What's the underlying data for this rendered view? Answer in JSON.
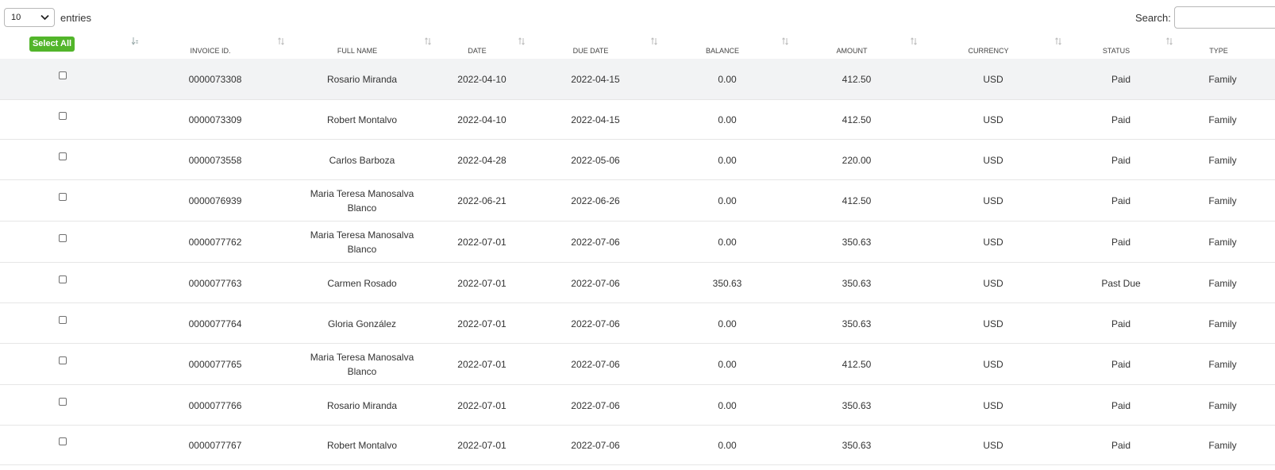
{
  "controls": {
    "page_length": "10",
    "entries_label": "entries",
    "search_label": "Search:",
    "search_value": ""
  },
  "header": {
    "select_all_label": "Select All",
    "columns": [
      {
        "key": "invoice_id",
        "label": "INVOICE ID."
      },
      {
        "key": "full_name",
        "label": "FULL NAME"
      },
      {
        "key": "date",
        "label": "DATE"
      },
      {
        "key": "due_date",
        "label": "DUE DATE"
      },
      {
        "key": "balance",
        "label": "BALANCE"
      },
      {
        "key": "amount",
        "label": "AMOUNT"
      },
      {
        "key": "currency",
        "label": "CURRENCY"
      },
      {
        "key": "status",
        "label": "STATUS"
      },
      {
        "key": "type",
        "label": "TYPE"
      }
    ]
  },
  "rows": [
    {
      "invoice_id": "0000073308",
      "full_name": "Rosario Miranda",
      "date": "2022-04-10",
      "due_date": "2022-04-15",
      "balance": "0.00",
      "amount": "412.50",
      "currency": "USD",
      "status": "Paid",
      "type": "Family"
    },
    {
      "invoice_id": "0000073309",
      "full_name": "Robert Montalvo",
      "date": "2022-04-10",
      "due_date": "2022-04-15",
      "balance": "0.00",
      "amount": "412.50",
      "currency": "USD",
      "status": "Paid",
      "type": "Family"
    },
    {
      "invoice_id": "0000073558",
      "full_name": "Carlos Barboza",
      "date": "2022-04-28",
      "due_date": "2022-05-06",
      "balance": "0.00",
      "amount": "220.00",
      "currency": "USD",
      "status": "Paid",
      "type": "Family"
    },
    {
      "invoice_id": "0000076939",
      "full_name": "Maria Teresa Manosalva Blanco",
      "date": "2022-06-21",
      "due_date": "2022-06-26",
      "balance": "0.00",
      "amount": "412.50",
      "currency": "USD",
      "status": "Paid",
      "type": "Family"
    },
    {
      "invoice_id": "0000077762",
      "full_name": "Maria Teresa Manosalva Blanco",
      "date": "2022-07-01",
      "due_date": "2022-07-06",
      "balance": "0.00",
      "amount": "350.63",
      "currency": "USD",
      "status": "Paid",
      "type": "Family"
    },
    {
      "invoice_id": "0000077763",
      "full_name": "Carmen Rosado",
      "date": "2022-07-01",
      "due_date": "2022-07-06",
      "balance": "350.63",
      "amount": "350.63",
      "currency": "USD",
      "status": "Past Due",
      "type": "Family"
    },
    {
      "invoice_id": "0000077764",
      "full_name": "Gloria González",
      "date": "2022-07-01",
      "due_date": "2022-07-06",
      "balance": "0.00",
      "amount": "350.63",
      "currency": "USD",
      "status": "Paid",
      "type": "Family"
    },
    {
      "invoice_id": "0000077765",
      "full_name": "Maria Teresa Manosalva Blanco",
      "date": "2022-07-01",
      "due_date": "2022-07-06",
      "balance": "0.00",
      "amount": "412.50",
      "currency": "USD",
      "status": "Paid",
      "type": "Family"
    },
    {
      "invoice_id": "0000077766",
      "full_name": "Rosario Miranda",
      "date": "2022-07-01",
      "due_date": "2022-07-06",
      "balance": "0.00",
      "amount": "350.63",
      "currency": "USD",
      "status": "Paid",
      "type": "Family"
    },
    {
      "invoice_id": "0000077767",
      "full_name": "Robert Montalvo",
      "date": "2022-07-01",
      "due_date": "2022-07-06",
      "balance": "0.00",
      "amount": "350.63",
      "currency": "USD",
      "status": "Paid",
      "type": "Family"
    }
  ],
  "colors": {
    "select_all_bg": "#52b52a",
    "highlight_row_bg": "#f2f3f4"
  },
  "icons": {
    "sort": "sort-arrows-icon",
    "dropdown": "chevron-down-icon"
  }
}
